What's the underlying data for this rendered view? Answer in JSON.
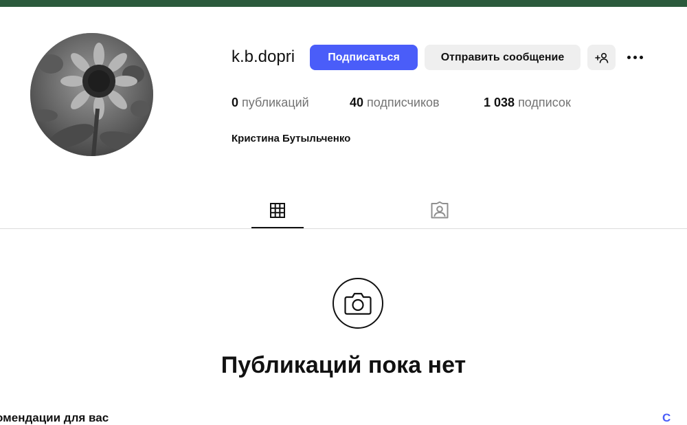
{
  "profile": {
    "username": "k.b.dopri",
    "full_name": "Кристина Бутыльченко",
    "avatar_icon": "sunflower-photo"
  },
  "actions": {
    "follow_label": "Подписаться",
    "message_label": "Отправить сообщение",
    "add_user_icon": "add-user-icon",
    "more_icon": "more-options-icon"
  },
  "stats": {
    "posts_count": "0",
    "posts_label": "публикаций",
    "followers_count": "40",
    "followers_label": "подписчиков",
    "following_count": "1 038",
    "following_label": "подписок"
  },
  "tabs": [
    {
      "icon": "grid-icon",
      "active": true
    },
    {
      "icon": "tagged-icon",
      "active": false
    }
  ],
  "empty_state": {
    "icon": "camera-icon",
    "title": "Публикаций пока нет"
  },
  "suggestions": {
    "label": "омендации для вас",
    "link": "С"
  },
  "colors": {
    "topbar": "#2b5a3c",
    "accent": "#4a5df9",
    "secondary_button": "#efefef",
    "muted_text": "#737373",
    "divider": "#dbdbdb"
  }
}
